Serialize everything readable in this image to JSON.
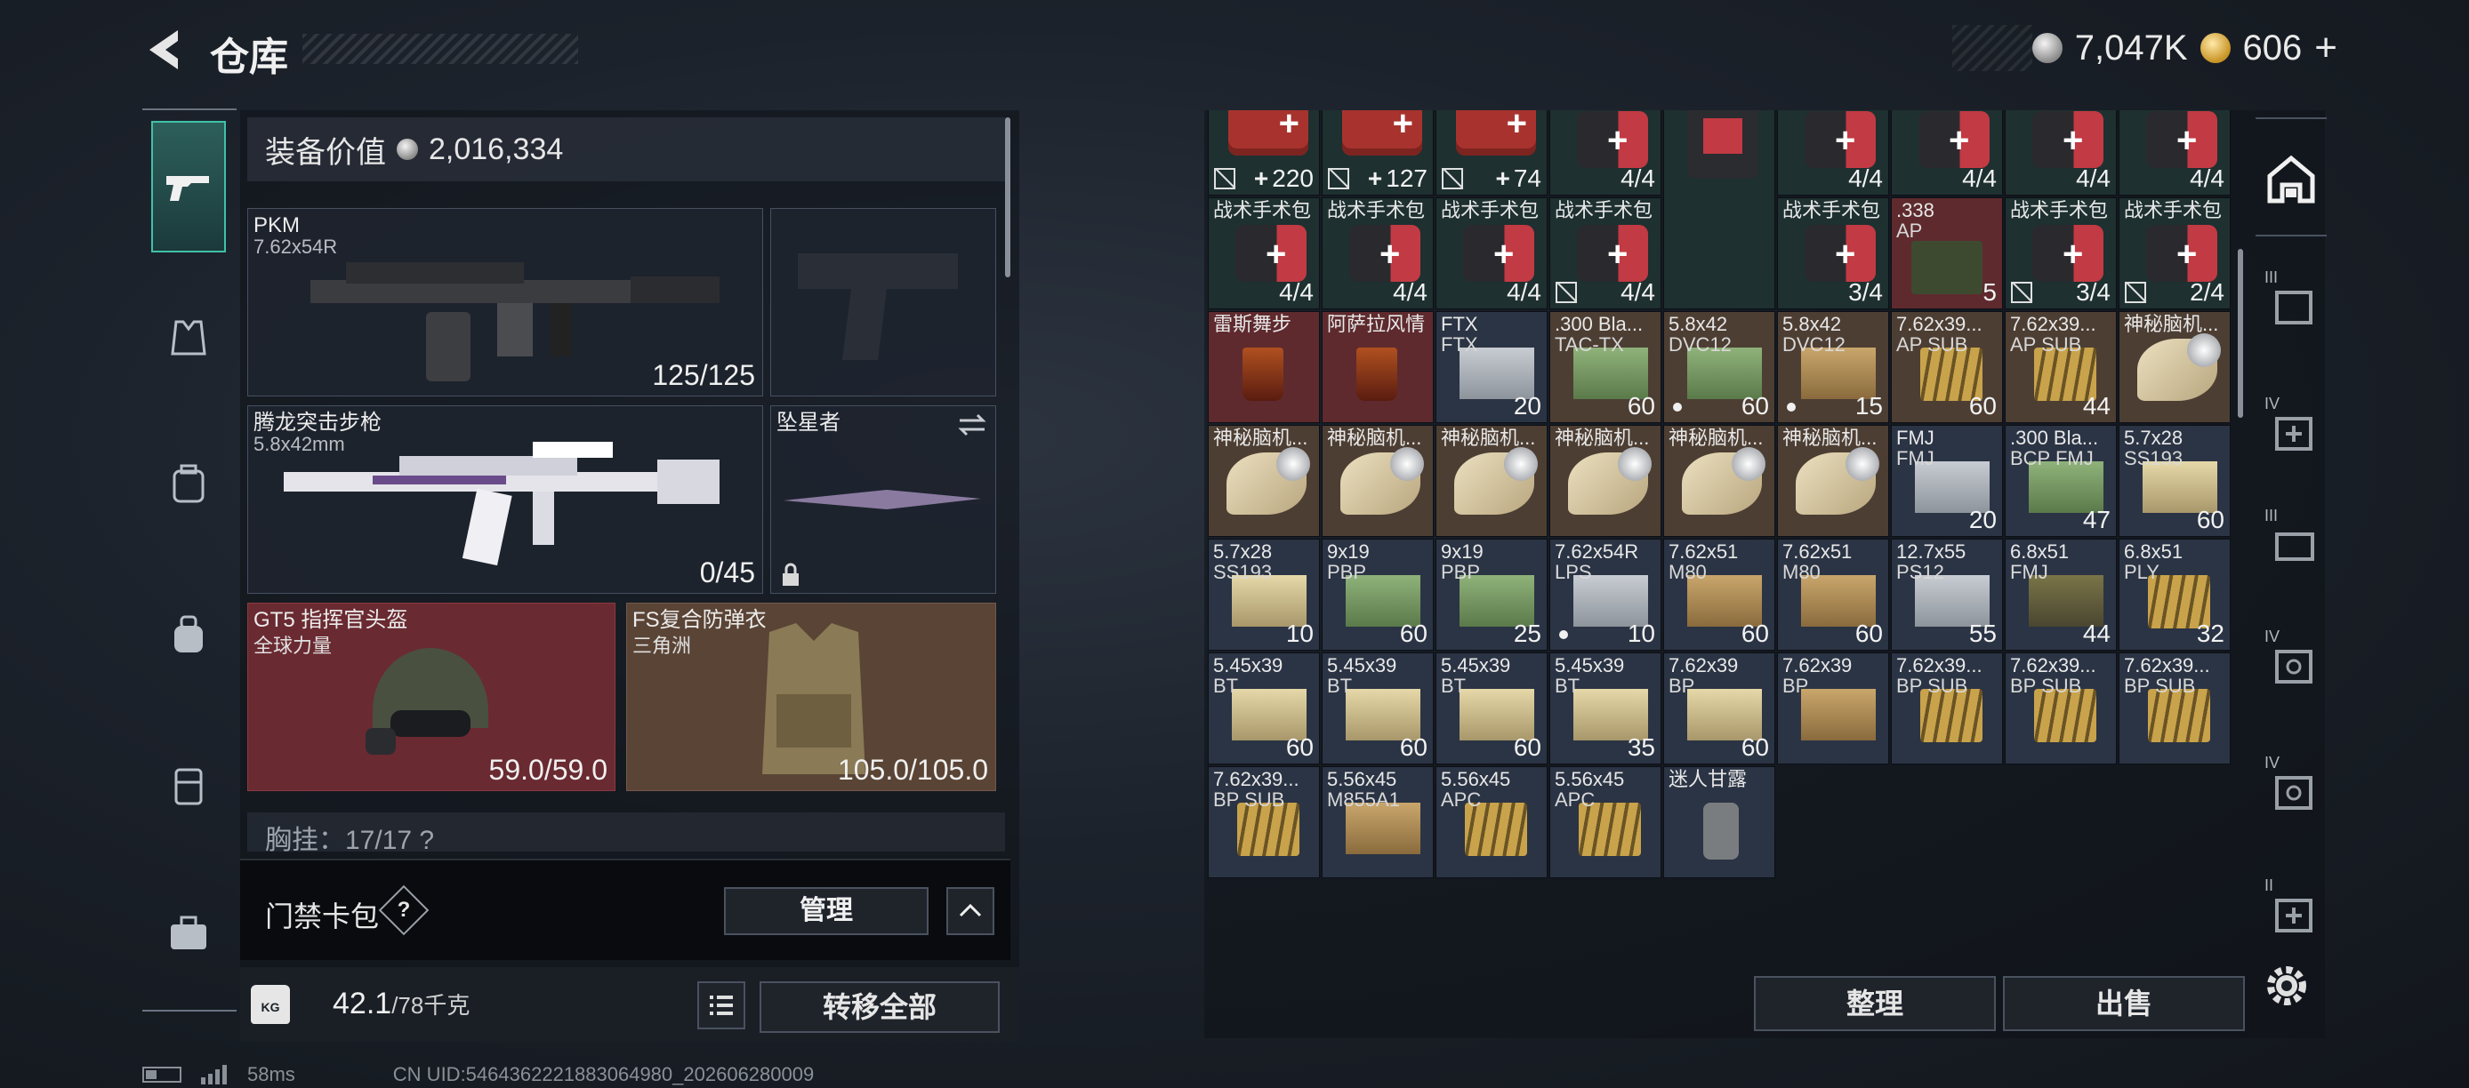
{
  "header": {
    "title": "仓库",
    "silver": "7,047K",
    "gold": "606",
    "gold_plus": "+"
  },
  "left_nav": {
    "items": [
      "gun-icon",
      "armor-icon",
      "backpack-icon",
      "bag-icon",
      "rig-icon",
      "case-icon"
    ]
  },
  "equipment": {
    "value_label": "装备价值",
    "value": "2,016,334",
    "primary": {
      "name": "PKM",
      "caliber": "7.62x54R",
      "ammo": "125/125"
    },
    "sidearm": {
      "name": ""
    },
    "secondary": {
      "name": "腾龙突击步枪",
      "caliber": "5.8x42mm",
      "ammo": "0/45"
    },
    "melee": {
      "name": "坠星者"
    },
    "helmet": {
      "name": "GT5 指挥官头盔",
      "brand": "全球力量",
      "durability": "59.0/59.0"
    },
    "armor": {
      "name": "FS复合防弹衣",
      "brand": "三角洲",
      "durability": "105.0/105.0"
    },
    "chest_row": "胸挂：17/17  ?"
  },
  "card_pack": {
    "label": "门禁卡包",
    "help": "?",
    "manage": "管理",
    "collapse": "^"
  },
  "weight": {
    "current": "42.1",
    "max": "/78千克"
  },
  "transfer_all": "转移全部",
  "status": {
    "ping": "58ms",
    "uid": "CN UID:5464362221883064980_202606280009"
  },
  "storage": {
    "cells": [
      {
        "name": "野战急救包",
        "qty": "220",
        "plus": true,
        "nocard": true,
        "bg": "green",
        "art": "medkit"
      },
      {
        "name": "野战急救包",
        "qty": "127",
        "plus": true,
        "nocard": true,
        "bg": "green",
        "art": "medkit"
      },
      {
        "name": "野战急救包",
        "qty": "74",
        "plus": true,
        "nocard": true,
        "bg": "green",
        "art": "medkit"
      },
      {
        "name": "战术手术包",
        "qty": "4/4",
        "bg": "green",
        "art": "kit"
      },
      {
        "name": "战术手术包",
        "qty": "",
        "bg": "green",
        "art": "cont"
      },
      {
        "name": "战术手术包",
        "qty": "4/4",
        "bg": "green",
        "art": "kit"
      },
      {
        "name": "战术手术包",
        "qty": "4/4",
        "bg": "green",
        "art": "kit"
      },
      {
        "name": "战术手术包",
        "qty": "4/4",
        "bg": "green",
        "art": "kit"
      },
      {
        "name": "战术手术包",
        "qty": "4/4",
        "bg": "green",
        "art": "kit"
      },
      {
        "name": "战术手术包",
        "qty": "4/4",
        "bg": "green",
        "art": "kit"
      },
      {
        "name": "战术手术包",
        "qty": "4/4",
        "bg": "green",
        "art": "kit"
      },
      {
        "name": "战术手术包",
        "qty": "4/4",
        "bg": "green",
        "art": "kit"
      },
      {
        "name": "战术手术包",
        "qty": "4/4",
        "nocard": true,
        "bg": "green",
        "art": "kit"
      },
      {
        "name": "战术手术包",
        "qty": "3/4",
        "bg": "green",
        "art": "kit"
      },
      {
        "name": ".338",
        "name2": "AP",
        "qty": "5",
        "bg": "red",
        "art": "ammo-can"
      },
      {
        "name": "战术手术包",
        "qty": "3/4",
        "nocard": true,
        "bg": "green",
        "art": "kit"
      },
      {
        "name": "战术手术包",
        "qty": "2/4",
        "nocard": true,
        "bg": "green",
        "art": "kit"
      },
      {
        "name": "雷斯舞步",
        "qty": "",
        "bg": "red",
        "art": "drink"
      },
      {
        "name": "阿萨拉风情",
        "qty": "",
        "bg": "red",
        "art": "drink"
      },
      {
        "name": "FTX",
        "name2": "FTX",
        "qty": "20",
        "bg": "blue",
        "art": "ammo-box grey"
      },
      {
        "name": ".300 Bla...",
        "name2": "TAC-TX",
        "qty": "60",
        "bg": "tan",
        "art": "ammo-box green"
      },
      {
        "name": "5.8x42",
        "name2": "DVC12",
        "qty": "60",
        "dot": true,
        "bg": "tan",
        "art": "ammo-box green"
      },
      {
        "name": "5.8x42",
        "name2": "DVC12",
        "qty": "15",
        "dot": true,
        "bg": "tan",
        "art": "ammo-box tan"
      },
      {
        "name": "7.62x39...",
        "name2": "AP SUB",
        "qty": "60",
        "bg": "tan",
        "art": "bullets"
      },
      {
        "name": "7.62x39...",
        "name2": "AP SUB",
        "qty": "44",
        "bg": "tan",
        "art": "bullets"
      },
      {
        "name": "神秘脑机...",
        "qty": "",
        "bg": "tan",
        "art": "strip"
      },
      {
        "name": "神秘脑机...",
        "qty": "",
        "bg": "tan",
        "art": "strip"
      },
      {
        "name": "神秘脑机...",
        "qty": "",
        "bg": "tan",
        "art": "strip"
      },
      {
        "name": "神秘脑机...",
        "qty": "",
        "bg": "tan",
        "art": "strip"
      },
      {
        "name": "神秘脑机...",
        "qty": "",
        "bg": "tan",
        "art": "strip"
      },
      {
        "name": "神秘脑机...",
        "qty": "",
        "bg": "tan",
        "art": "strip"
      },
      {
        "name": "神秘脑机...",
        "qty": "",
        "bg": "tan",
        "art": "strip"
      },
      {
        "name": "FMJ",
        "name2": "FMJ",
        "qty": "20",
        "bg": "blue",
        "art": "ammo-box grey"
      },
      {
        "name": ".300 Bla...",
        "name2": "BCP FMJ",
        "qty": "47",
        "bg": "blue",
        "art": "ammo-box green"
      },
      {
        "name": "5.7x28",
        "name2": "SS193",
        "qty": "60",
        "bg": "blue",
        "art": "ammo-box cream"
      },
      {
        "name": "5.7x28",
        "name2": "SS193",
        "qty": "10",
        "bg": "blue",
        "art": "ammo-box cream"
      },
      {
        "name": "9x19",
        "name2": "PBP",
        "qty": "60",
        "bg": "blue",
        "art": "ammo-box green"
      },
      {
        "name": "9x19",
        "name2": "PBP",
        "qty": "25",
        "bg": "blue",
        "art": "ammo-box green"
      },
      {
        "name": "7.62x54R",
        "name2": "LPS",
        "qty": "10",
        "dot": true,
        "bg": "blue",
        "art": "ammo-box grey"
      },
      {
        "name": "7.62x51",
        "name2": "M80",
        "qty": "60",
        "bg": "blue",
        "art": "ammo-box tan"
      },
      {
        "name": "7.62x51",
        "name2": "M80",
        "qty": "60",
        "bg": "blue",
        "art": "ammo-box tan"
      },
      {
        "name": "12.7x55",
        "name2": "PS12",
        "qty": "55",
        "bg": "blue",
        "art": "ammo-box grey"
      },
      {
        "name": "6.8x51",
        "name2": "FMJ",
        "qty": "44",
        "bg": "blue",
        "art": "ammo-box olive"
      },
      {
        "name": "6.8x51",
        "name2": "PLY",
        "qty": "32",
        "bg": "blue",
        "art": "bullets"
      },
      {
        "name": "5.45x39",
        "name2": "BT",
        "qty": "60",
        "bg": "blue",
        "art": "ammo-box cream"
      },
      {
        "name": "5.45x39",
        "name2": "BT",
        "qty": "60",
        "bg": "blue",
        "art": "ammo-box cream"
      },
      {
        "name": "5.45x39",
        "name2": "BT",
        "qty": "60",
        "bg": "blue",
        "art": "ammo-box cream"
      },
      {
        "name": "5.45x39",
        "name2": "BT",
        "qty": "35",
        "bg": "blue",
        "art": "ammo-box cream"
      },
      {
        "name": "7.62x39",
        "name2": "BP",
        "qty": "60",
        "bg": "blue",
        "art": "ammo-box cream"
      },
      {
        "name": "7.62x39",
        "name2": "BP",
        "qty": "",
        "bg": "blue",
        "art": "ammo-box tan"
      },
      {
        "name": "7.62x39...",
        "name2": "BP SUB",
        "qty": "",
        "bg": "blue",
        "art": "bullets"
      },
      {
        "name": "7.62x39...",
        "name2": "BP SUB",
        "qty": "",
        "bg": "blue",
        "art": "bullets"
      },
      {
        "name": "7.62x39...",
        "name2": "BP SUB",
        "qty": "",
        "bg": "blue",
        "art": "bullets"
      },
      {
        "name": "7.62x39...",
        "name2": "BP SUB",
        "qty": "",
        "bg": "blue",
        "art": "bullets"
      },
      {
        "name": "5.56x45",
        "name2": "M855A1",
        "qty": "",
        "bg": "blue",
        "art": "ammo-box tan"
      },
      {
        "name": "5.56x45",
        "name2": "APC",
        "qty": "",
        "bg": "blue",
        "art": "bullets"
      },
      {
        "name": "5.56x45",
        "name2": "APC",
        "qty": "",
        "bg": "blue",
        "art": "bullets"
      },
      {
        "name": "迷人甘露",
        "qty": "",
        "bg": "blue",
        "art": "jar"
      }
    ]
  },
  "right_rail": {
    "labels": [
      "",
      "III",
      "IV",
      "III",
      "IV",
      "IV",
      "II"
    ]
  },
  "sort": "整理",
  "sell": "出售",
  "colors": {
    "accent": "#3fc1a9",
    "slot_red": "#6a2a31",
    "slot_tan": "#5a4435"
  }
}
